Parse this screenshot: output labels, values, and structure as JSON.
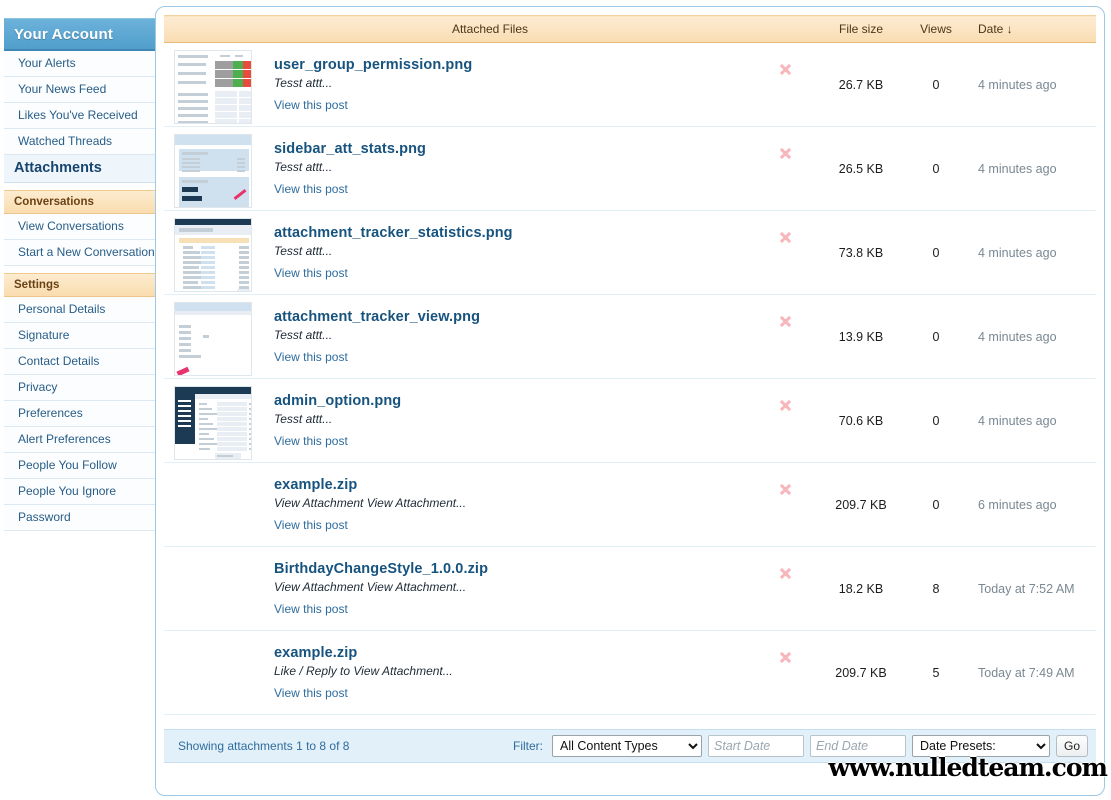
{
  "sidebar": {
    "header": "Your Account",
    "groups": [
      {
        "type": "links",
        "items": [
          {
            "label": "Your Alerts",
            "selected": false
          },
          {
            "label": "Your News Feed",
            "selected": false
          },
          {
            "label": "Likes You've Received",
            "selected": false
          },
          {
            "label": "Watched Threads",
            "selected": false
          },
          {
            "label": "Attachments",
            "selected": true
          }
        ]
      },
      {
        "type": "category",
        "title": "Conversations",
        "items": [
          {
            "label": "View Conversations",
            "selected": false
          },
          {
            "label": "Start a New Conversation",
            "selected": false
          }
        ]
      },
      {
        "type": "category",
        "title": "Settings",
        "items": [
          {
            "label": "Personal Details",
            "selected": false
          },
          {
            "label": "Signature",
            "selected": false
          },
          {
            "label": "Contact Details",
            "selected": false
          },
          {
            "label": "Privacy",
            "selected": false
          },
          {
            "label": "Preferences",
            "selected": false
          },
          {
            "label": "Alert Preferences",
            "selected": false
          },
          {
            "label": "People You Follow",
            "selected": false
          },
          {
            "label": "People You Ignore",
            "selected": false
          },
          {
            "label": "Password",
            "selected": false
          }
        ]
      }
    ]
  },
  "table": {
    "headers": {
      "file": "Attached Files",
      "size": "File size",
      "views": "Views",
      "date": "Date ↓"
    },
    "view_post_label": "View this post",
    "delete_icon": "delete-x-icon",
    "rows": [
      {
        "filename": "user_group_permission.png",
        "description": "Tesst attt...",
        "size": "26.7 KB",
        "views": "0",
        "date": "4 minutes ago",
        "thumb": "permissions"
      },
      {
        "filename": "sidebar_att_stats.png",
        "description": "Tesst attt...",
        "size": "26.5 KB",
        "views": "0",
        "date": "4 minutes ago",
        "thumb": "sidebar"
      },
      {
        "filename": "attachment_tracker_statistics.png",
        "description": "Tesst attt...",
        "size": "73.8 KB",
        "views": "0",
        "date": "4 minutes ago",
        "thumb": "stats"
      },
      {
        "filename": "attachment_tracker_view.png",
        "description": "Tesst attt...",
        "size": "13.9 KB",
        "views": "0",
        "date": "4 minutes ago",
        "thumb": "view"
      },
      {
        "filename": "admin_option.png",
        "description": "Tesst attt...",
        "size": "70.6 KB",
        "views": "0",
        "date": "4 minutes ago",
        "thumb": "admin"
      },
      {
        "filename": "example.zip",
        "description": "View Attachment View Attachment...",
        "size": "209.7 KB",
        "views": "0",
        "date": "6 minutes ago",
        "thumb": "none"
      },
      {
        "filename": "BirthdayChangeStyle_1.0.0.zip",
        "description": "View Attachment View Attachment...",
        "size": "18.2 KB",
        "views": "8",
        "date": "Today at 7:52 AM",
        "thumb": "none"
      },
      {
        "filename": "example.zip",
        "description": "Like / Reply to View Attachment...",
        "size": "209.7 KB",
        "views": "5",
        "date": "Today at 7:49 AM",
        "thumb": "none"
      }
    ]
  },
  "footer": {
    "showing": "Showing attachments 1 to 8 of 8",
    "filter_label": "Filter:",
    "content_type_selected": "All Content Types",
    "start_date_placeholder": "Start Date",
    "start_date_value": "",
    "end_date_placeholder": "End Date",
    "end_date_value": "",
    "date_presets_selected": "Date Presets:",
    "go_label": "Go"
  },
  "watermark": "www.nulledteam.com",
  "colors": {
    "sidebar_header": "#519fcd",
    "panel_border": "#9cc9e3",
    "table_header": "#f9dcb0",
    "category_header": "#f9dcae",
    "link": "#17537f",
    "footer_bar": "#e2f0fa",
    "delete_icon": "#f7b6bc"
  }
}
